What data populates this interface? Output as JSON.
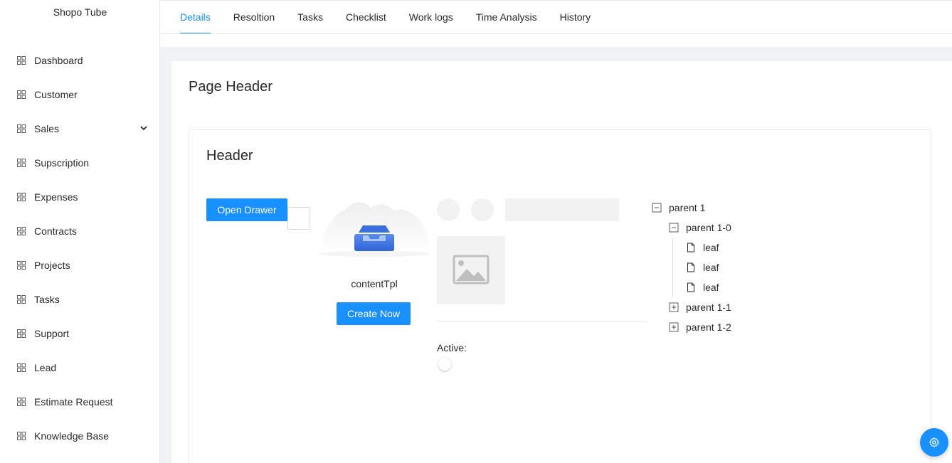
{
  "brand": "Shopo Tube",
  "sidebar": {
    "items": [
      {
        "label": "Dashboard"
      },
      {
        "label": "Customer"
      },
      {
        "label": "Sales"
      },
      {
        "label": "Supscription"
      },
      {
        "label": "Expenses"
      },
      {
        "label": "Contracts"
      },
      {
        "label": "Projects"
      },
      {
        "label": "Tasks"
      },
      {
        "label": "Support"
      },
      {
        "label": "Lead"
      },
      {
        "label": "Estimate Request"
      },
      {
        "label": "Knowledge Base"
      }
    ]
  },
  "tabs": [
    {
      "label": "Details",
      "active": true
    },
    {
      "label": "Resoltion"
    },
    {
      "label": "Tasks"
    },
    {
      "label": "Checklist"
    },
    {
      "label": "Work logs"
    },
    {
      "label": "Time Analysis"
    },
    {
      "label": "History"
    }
  ],
  "page": {
    "title": "Page Header",
    "header": "Header",
    "open_drawer_label": "Open Drawer",
    "empty_description": "contentTpl",
    "create_now_label": "Create Now",
    "active_label": "Active:"
  },
  "tree": {
    "parent1": "parent 1",
    "parent10": "parent 1-0",
    "leaf1": "leaf",
    "leaf2": "leaf",
    "leaf3": "leaf",
    "parent11": "parent 1-1",
    "parent12": "parent 1-2"
  },
  "colors": {
    "primary": "#1890ff",
    "skeleton": "#f2f2f2",
    "background": "#f0f2f5"
  },
  "icons": {
    "menu_item": "appstore-icon",
    "submenu": "chevron-down-icon",
    "settings": "gear-icon"
  }
}
